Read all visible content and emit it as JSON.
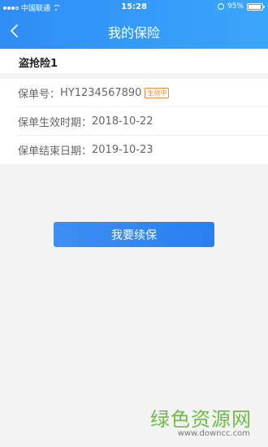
{
  "status_bar": {
    "carrier": "中国联通",
    "time": "15:28",
    "battery": "95%",
    "battery_level": 0.95
  },
  "header": {
    "title": "我的保险",
    "back_icon": "chevron-left-icon"
  },
  "policy": {
    "name": "盗抢险1",
    "number_label": "保单号：",
    "number_value": "HY1234567890",
    "status_badge": "生效中",
    "status_color": "#f08a3e",
    "effective_label": "保单生效时期：",
    "effective_value": "2018-10-22",
    "end_label": "保单结束日期：",
    "end_value": "2019-10-23"
  },
  "actions": {
    "renew_label": "我要续保"
  },
  "watermark": {
    "text": "绿色资源网",
    "url": "www.downcc.com"
  },
  "colors": {
    "primary": "#2f8df6",
    "background": "#f4f4f4",
    "watermark": "#6dbd45"
  }
}
